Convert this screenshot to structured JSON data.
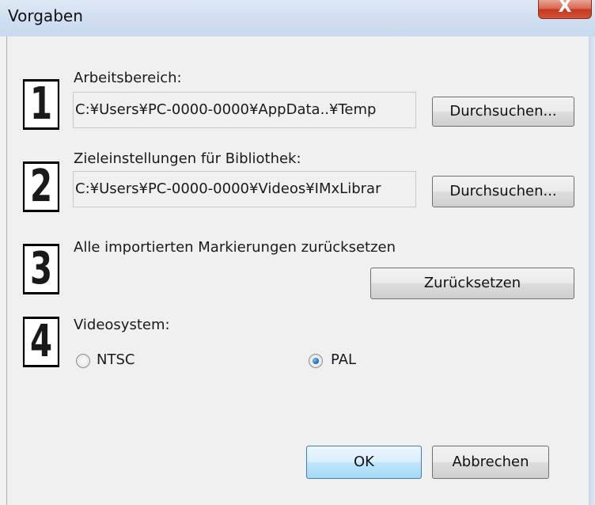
{
  "window": {
    "title": "Vorgaben",
    "close_glyph": "X"
  },
  "sections": [
    {
      "badge": "1",
      "label": "Arbeitsbereich:",
      "path": "C:¥Users¥PC-0000-0000¥AppData..¥Temp",
      "button": "Durchsuchen..."
    },
    {
      "badge": "2",
      "label": "Zieleinstellungen für Bibliothek:",
      "path": "C:¥Users¥PC-0000-0000¥Videos¥IMxLibrar",
      "button": "Durchsuchen..."
    },
    {
      "badge": "3",
      "label": "Alle importierten Markierungen zurücksetzen",
      "button": "Zurücksetzen"
    },
    {
      "badge": "4",
      "label": "Videosystem:",
      "options": [
        {
          "label": "NTSC",
          "selected": false
        },
        {
          "label": "PAL",
          "selected": true
        }
      ]
    }
  ],
  "footer": {
    "ok_label": "OK",
    "cancel_label": "Abbrechen"
  }
}
